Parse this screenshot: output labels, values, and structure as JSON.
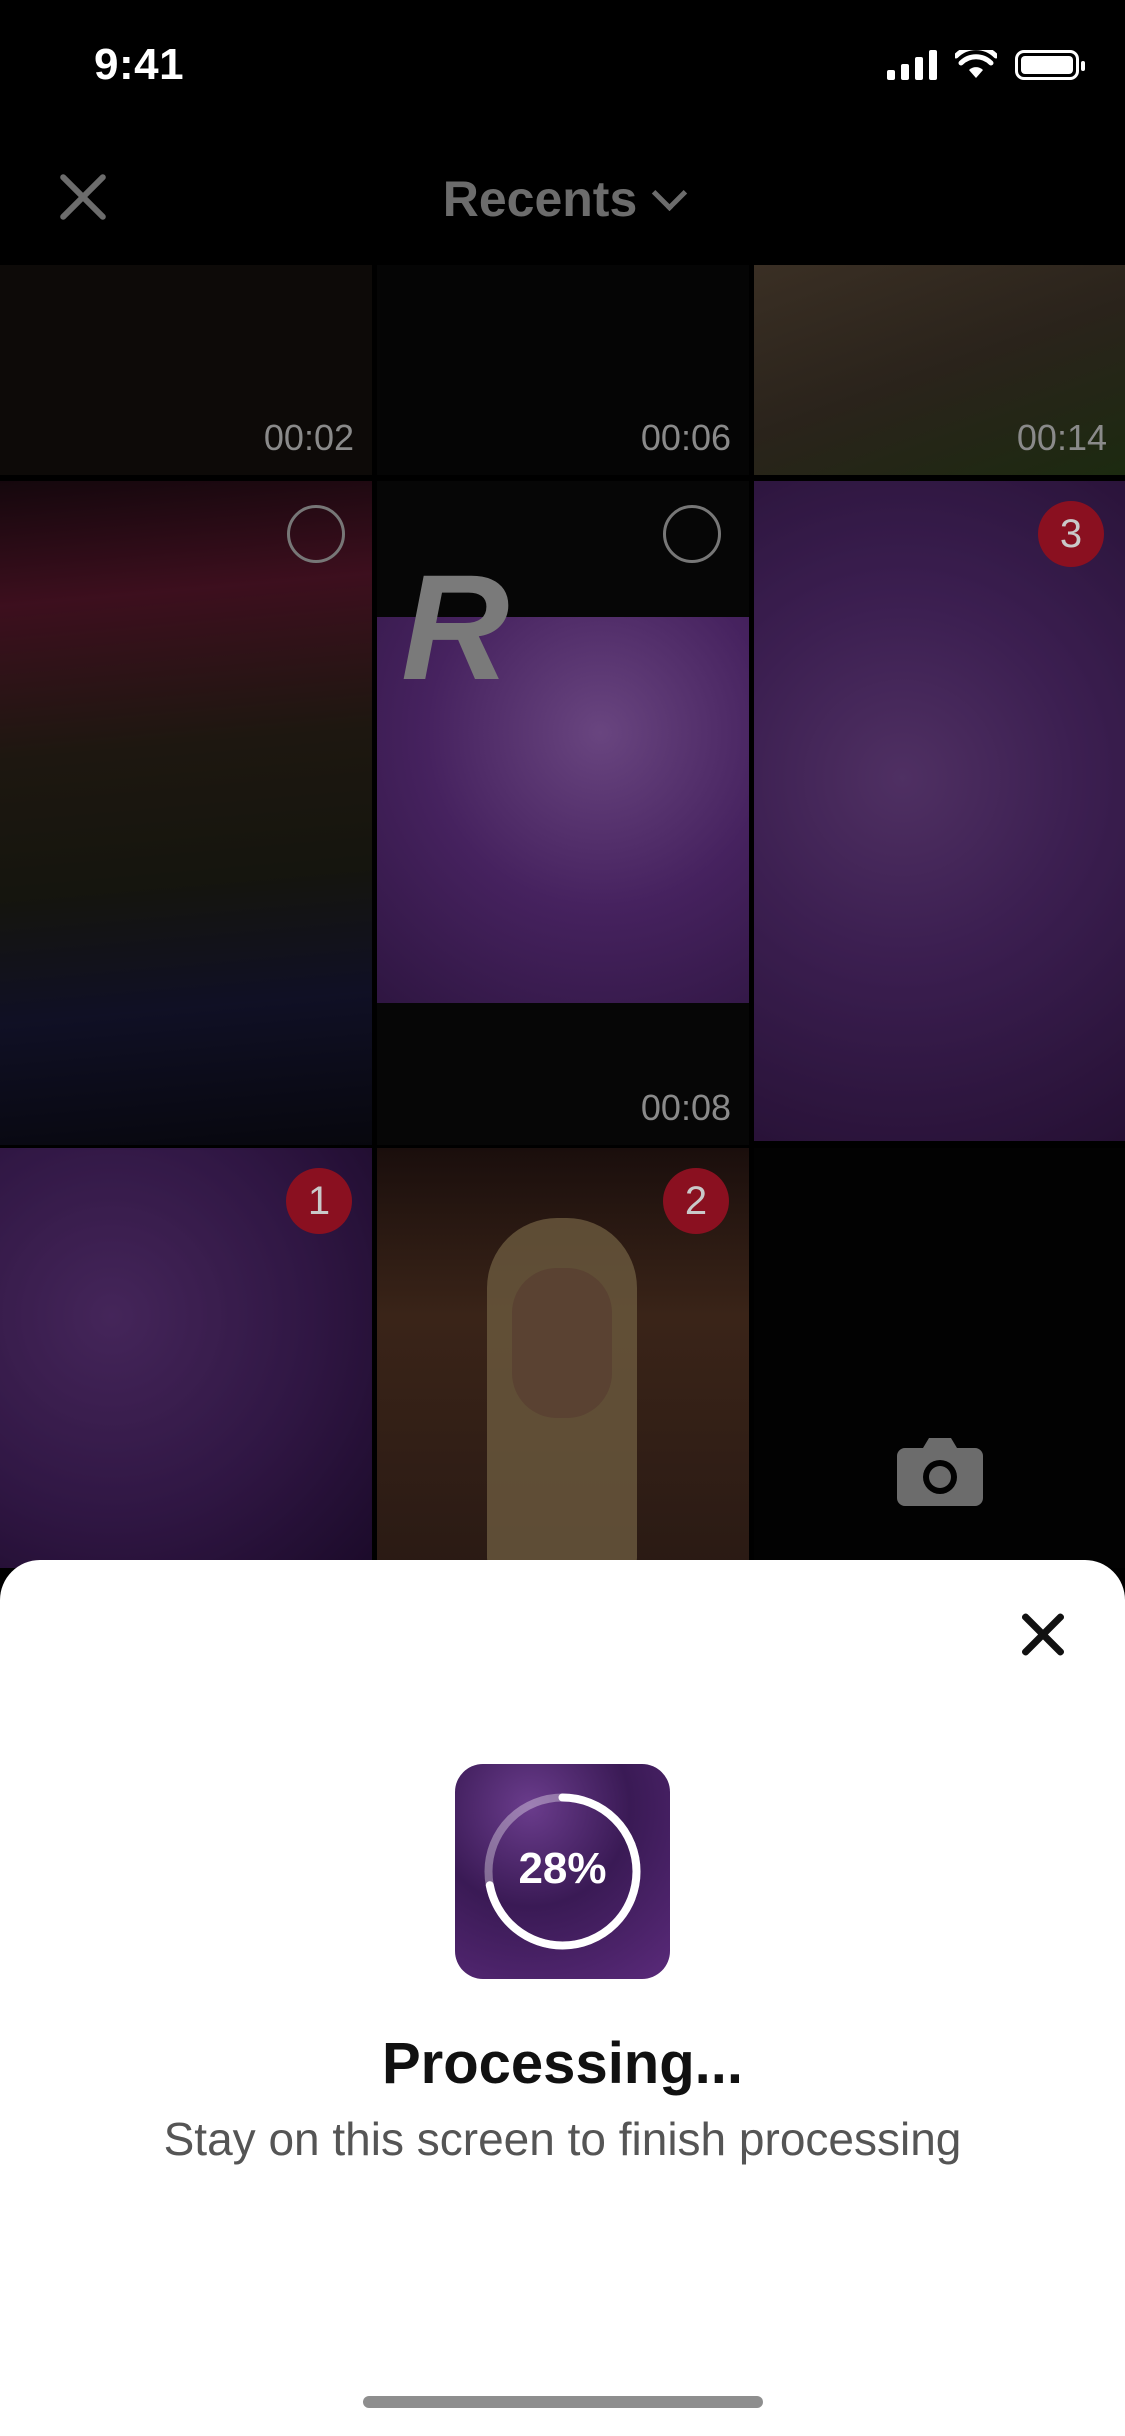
{
  "status_bar": {
    "time": "9:41"
  },
  "header": {
    "title": "Recents"
  },
  "grid": {
    "durations": [
      "00:02",
      "00:06",
      "00:14",
      "00:08"
    ],
    "selection_numbers": [
      "1",
      "2",
      "3"
    ],
    "r_logo_text": "R"
  },
  "processing": {
    "percent_label": "28%",
    "progress": 0.28,
    "title": "Processing...",
    "subtitle": "Stay on this screen to finish processing"
  },
  "colors": {
    "sheet_bg": "#ffffff",
    "selection_badge": "#d0223a",
    "screen_bg": "#000000"
  }
}
